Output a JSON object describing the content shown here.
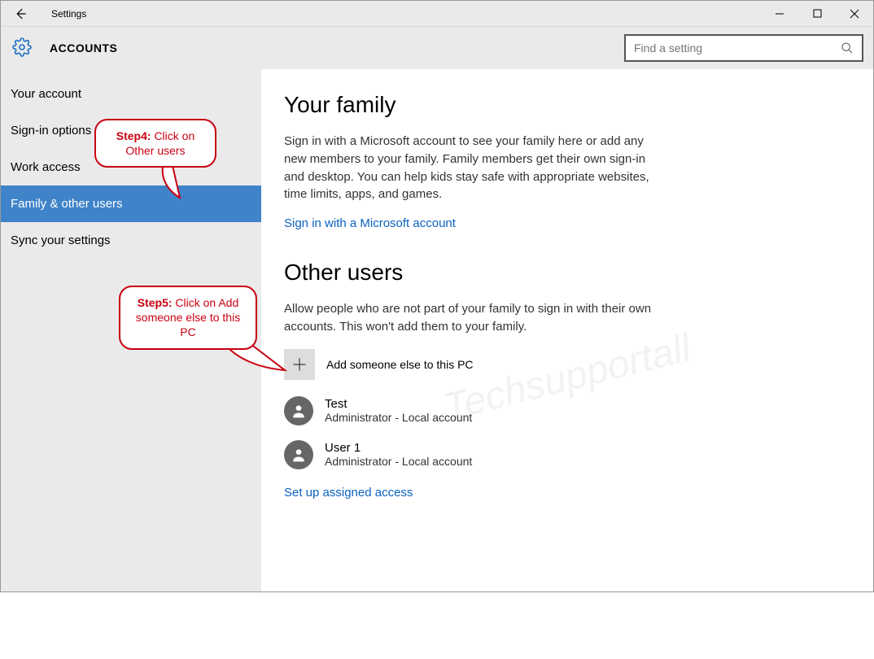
{
  "window": {
    "title": "Settings",
    "section": "ACCOUNTS",
    "search_placeholder": "Find a setting"
  },
  "sidebar": {
    "items": [
      {
        "label": "Your account"
      },
      {
        "label": "Sign-in options"
      },
      {
        "label": "Work access"
      },
      {
        "label": "Family & other users"
      },
      {
        "label": "Sync your settings"
      }
    ]
  },
  "family": {
    "heading": "Your family",
    "description": "Sign in with a Microsoft account to see your family here or add any new members to your family. Family members get their own sign-in and desktop. You can help kids stay safe with appropriate websites, time limits, apps, and games.",
    "signin_link": "Sign in with a Microsoft account"
  },
  "other_users": {
    "heading": "Other users",
    "description": "Allow people who are not part of your family to sign in with their own accounts. This won't add them to your family.",
    "add_label": "Add someone else to this PC",
    "users": [
      {
        "name": "Test",
        "role": "Administrator - Local account"
      },
      {
        "name": "User 1",
        "role": "Administrator - Local account"
      }
    ],
    "assigned_access_link": "Set up assigned access"
  },
  "callouts": {
    "step4": {
      "step": "Step4:",
      "text": "Click on Other users"
    },
    "step5": {
      "step": "Step5:",
      "text": "Click on Add someone else to this PC"
    }
  },
  "watermark": "Techsupportall"
}
